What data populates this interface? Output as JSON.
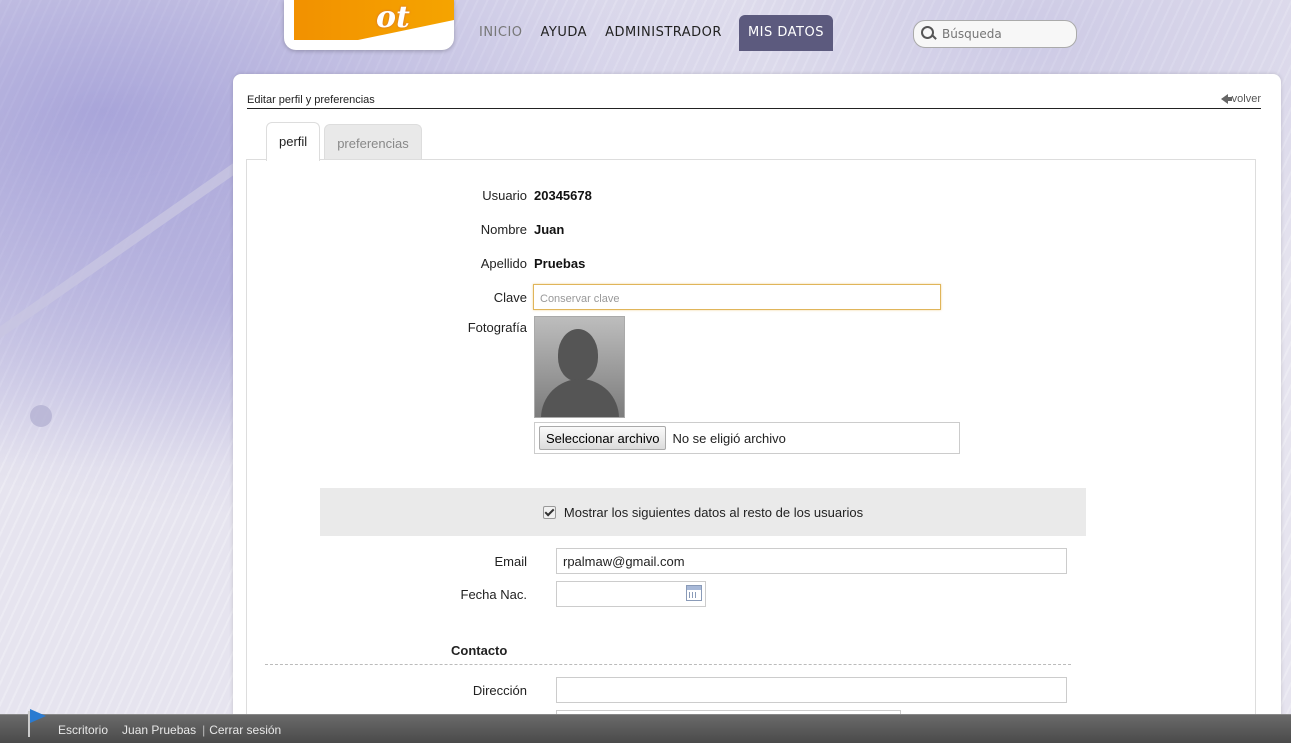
{
  "nav": {
    "items": [
      {
        "label": "INICIO",
        "muted": true
      },
      {
        "label": "AYUDA"
      },
      {
        "label": "ADMINISTRADOR"
      },
      {
        "label": "MIS DATOS",
        "active": true
      }
    ],
    "search_placeholder": "Búsqueda"
  },
  "page": {
    "title": "Editar perfil y preferencias",
    "back_label": "volver",
    "tabs": [
      {
        "label": "perfil",
        "active": true
      },
      {
        "label": "preferencias"
      }
    ]
  },
  "profile": {
    "usuario_label": "Usuario",
    "usuario_value": "20345678",
    "nombre_label": "Nombre",
    "nombre_value": "Juan",
    "apellido_label": "Apellido",
    "apellido_value": "Pruebas",
    "clave_label": "Clave",
    "clave_placeholder": "Conservar clave",
    "foto_label": "Fotografía",
    "file_button": "Seleccionar archivo",
    "file_status": "No se eligió archivo"
  },
  "share": {
    "label": "Mostrar los siguientes datos al resto de los usuarios",
    "checked": true
  },
  "details": {
    "email_label": "Email",
    "email_value": "rpalmaw@gmail.com",
    "fecha_label": "Fecha Nac.",
    "fecha_value": ""
  },
  "contacto": {
    "title": "Contacto",
    "direccion_label": "Dirección",
    "direccion_value": ""
  },
  "taskbar": {
    "escritorio": "Escritorio",
    "user": "Juan Pruebas",
    "separator": "|",
    "logout": "Cerrar sesión"
  }
}
